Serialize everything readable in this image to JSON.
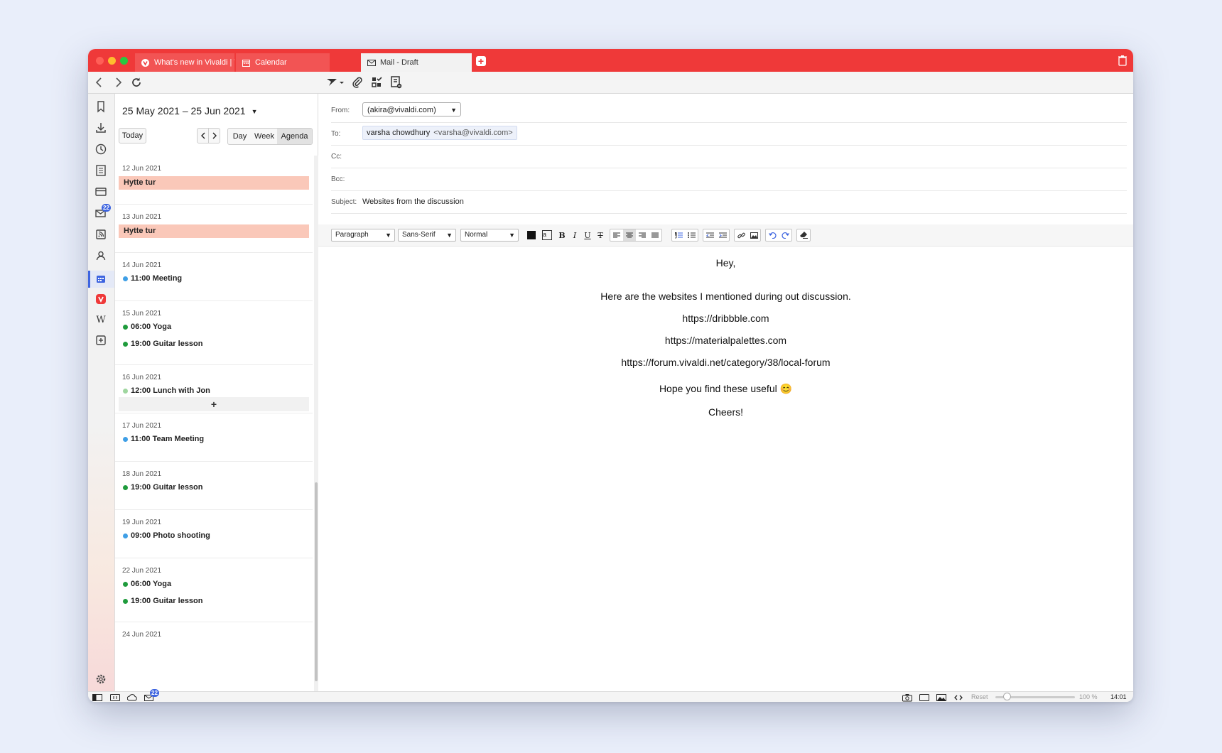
{
  "browser": {
    "tabs": [
      {
        "label": "What's new in Vivaldi | Viv",
        "icon": "vivaldi-icon",
        "active": false
      },
      {
        "label": "Calendar",
        "icon": "calendar-icon",
        "active": false
      },
      {
        "label": "Mail - Draft",
        "icon": "mail-icon",
        "active": true
      }
    ],
    "accent_color": "#ef3939"
  },
  "side_panel": {
    "icons": [
      "bookmark-icon",
      "download-icon",
      "history-icon",
      "notes-icon",
      "reading-list-icon",
      "mail-icon",
      "feeds-icon",
      "contacts-icon",
      "calendar-icon",
      "vivaldi-icon",
      "wikipedia-icon",
      "add-panel-icon"
    ],
    "mail_badge": "22",
    "settings_icon": "gear-icon"
  },
  "calendar": {
    "date_range": "25 May 2021 – 25 Jun 2021",
    "today_label": "Today",
    "views": [
      "Day",
      "Week",
      "Agenda"
    ],
    "selected_view": "Agenda",
    "add_label": "+",
    "days": [
      {
        "date": "12 Jun 2021",
        "events": [
          {
            "time": "",
            "title": "Hytte tur",
            "all_day": true
          }
        ]
      },
      {
        "date": "13 Jun 2021",
        "events": [
          {
            "time": "",
            "title": "Hytte tur",
            "all_day": true
          }
        ]
      },
      {
        "date": "14 Jun 2021",
        "events": [
          {
            "text": "11:00 Meeting",
            "color": "#3f9fe6"
          }
        ]
      },
      {
        "date": "15 Jun 2021",
        "events": [
          {
            "text": "06:00 Yoga",
            "color": "#1f9b3c"
          },
          {
            "text": "19:00 Guitar lesson",
            "color": "#1f9b3c"
          }
        ]
      },
      {
        "date": "16 Jun 2021",
        "events": [
          {
            "text": "12:00 Lunch with Jon",
            "color": "#9fd69f"
          }
        ]
      },
      {
        "date": "17 Jun 2021",
        "events": [
          {
            "text": "11:00 Team Meeting",
            "color": "#3f9fe6"
          }
        ]
      },
      {
        "date": "18 Jun 2021",
        "events": [
          {
            "text": "19:00 Guitar lesson",
            "color": "#1f9b3c"
          }
        ]
      },
      {
        "date": "19 Jun 2021",
        "events": [
          {
            "text": "09:00 Photo shooting",
            "color": "#3f9fe6"
          }
        ]
      },
      {
        "date": "22 Jun 2021",
        "events": [
          {
            "text": "06:00 Yoga",
            "color": "#1f9b3c"
          },
          {
            "text": "19:00 Guitar lesson",
            "color": "#1f9b3c"
          }
        ]
      },
      {
        "date": "24 Jun 2021",
        "events": []
      }
    ]
  },
  "compose": {
    "from_label": "From:",
    "from_value": "(akira@vivaldi.com)",
    "to_label": "To:",
    "to_name": "varsha chowdhury",
    "to_address": "<varsha@vivaldi.com>",
    "cc_label": "Cc:",
    "bcc_label": "Bcc:",
    "subject_label": "Subject:",
    "subject_value": "Websites from the discussion",
    "format": {
      "block": "Paragraph",
      "font": "Sans-Serif",
      "size": "Normal"
    },
    "body": [
      "Hey,",
      "Here are the websites I mentioned during out discussion.",
      "https://dribbble.com",
      "https://materialpalettes.com",
      "https://forum.vivaldi.net/category/38/local-forum",
      "Hope you find these useful 😊",
      "Cheers!"
    ]
  },
  "status": {
    "mail_badge": "22",
    "reset_label": "Reset",
    "zoom": "100 %",
    "zoom_fraction": 0.15,
    "clock": "14:01"
  }
}
